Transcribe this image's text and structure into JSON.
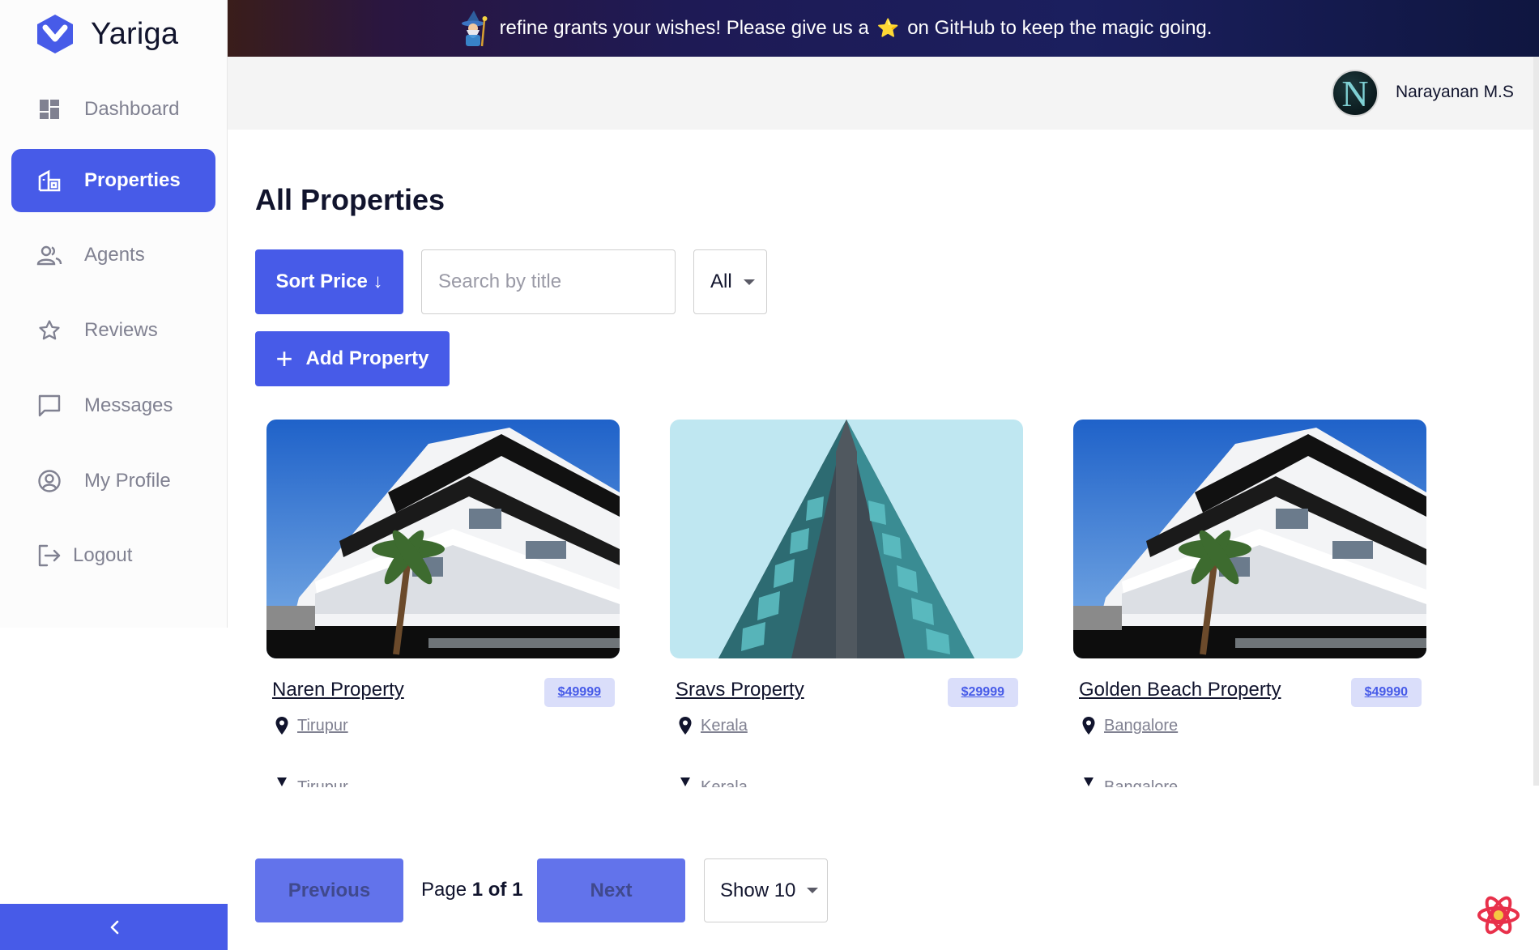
{
  "app": {
    "name": "Yariga"
  },
  "sidebar": {
    "items": [
      {
        "label": "Dashboard",
        "icon": "dashboard-icon"
      },
      {
        "label": "Properties",
        "icon": "properties-icon",
        "active": true
      },
      {
        "label": "Agents",
        "icon": "agents-icon"
      },
      {
        "label": "Reviews",
        "icon": "star-icon"
      },
      {
        "label": "Messages",
        "icon": "chat-icon"
      },
      {
        "label": "My Profile",
        "icon": "profile-icon"
      },
      {
        "label": "Logout",
        "icon": "logout-icon"
      }
    ],
    "collapse_icon": "chevron-left-icon"
  },
  "banner": {
    "text_before": "refine grants your wishes! Please give us a",
    "text_after": "on GitHub to keep the magic going.",
    "star": "⭐"
  },
  "header": {
    "user_name": "Narayanan M.S",
    "avatar_letter": "N"
  },
  "main": {
    "title": "All Properties",
    "sort_label": "Sort Price ↓",
    "search_placeholder": "Search by title",
    "filter_value": "All",
    "add_label": "Add Property"
  },
  "properties": [
    {
      "title": "Naren Property",
      "price": "$49999",
      "location": "Tirupur",
      "image": "white-building"
    },
    {
      "title": "Sravs Property",
      "price": "$29999",
      "location": "Kerala",
      "image": "teal-tower"
    },
    {
      "title": "Golden Beach Property",
      "price": "$49990",
      "location": "Bangalore",
      "image": "white-building"
    }
  ],
  "pagination": {
    "prev_label": "Previous",
    "next_label": "Next",
    "page_word": "Page",
    "current": "1",
    "of_word": "of",
    "total": "1",
    "show_label": "Show 10"
  },
  "colors": {
    "accent": "#475be8",
    "price_bg": "#dadefa",
    "muted": "#808191"
  }
}
